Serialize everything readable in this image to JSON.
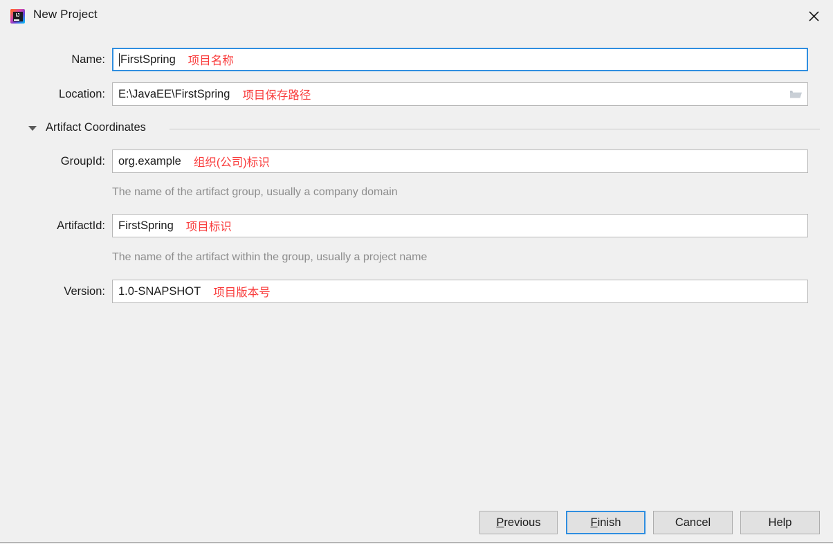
{
  "window": {
    "title": "New Project",
    "app_icon": "intellij-idea-icon",
    "close_icon": "close-icon"
  },
  "form": {
    "name": {
      "label": "Name:",
      "value": "FirstSpring",
      "annotation": "项目名称"
    },
    "location": {
      "label": "Location:",
      "value": "E:\\JavaEE\\FirstSpring",
      "annotation": "项目保存路径",
      "browse_icon": "folder-icon"
    },
    "artifact_section": {
      "label": "Artifact Coordinates",
      "expanded": true,
      "toggle_icon": "chevron-down-icon"
    },
    "group_id": {
      "label": "GroupId:",
      "value": "org.example",
      "annotation": "组织(公司)标识",
      "hint": "The name of the artifact group, usually a company domain"
    },
    "artifact_id": {
      "label": "ArtifactId:",
      "value": "FirstSpring",
      "annotation": "项目标识",
      "hint": "The name of the artifact within the group, usually a project name"
    },
    "version": {
      "label": "Version:",
      "value": "1.0-SNAPSHOT",
      "annotation": "项目版本号"
    }
  },
  "buttons": {
    "previous": {
      "mnemonic": "P",
      "rest": "revious"
    },
    "finish": {
      "mnemonic": "F",
      "rest": "inish"
    },
    "cancel": {
      "label": "Cancel"
    },
    "help": {
      "label": "Help"
    }
  },
  "colors": {
    "accent": "#2f8ee0",
    "annotation_red": "#f93b3b",
    "dialog_bg": "#f0f0f0",
    "hint_gray": "#8d8d8d"
  }
}
